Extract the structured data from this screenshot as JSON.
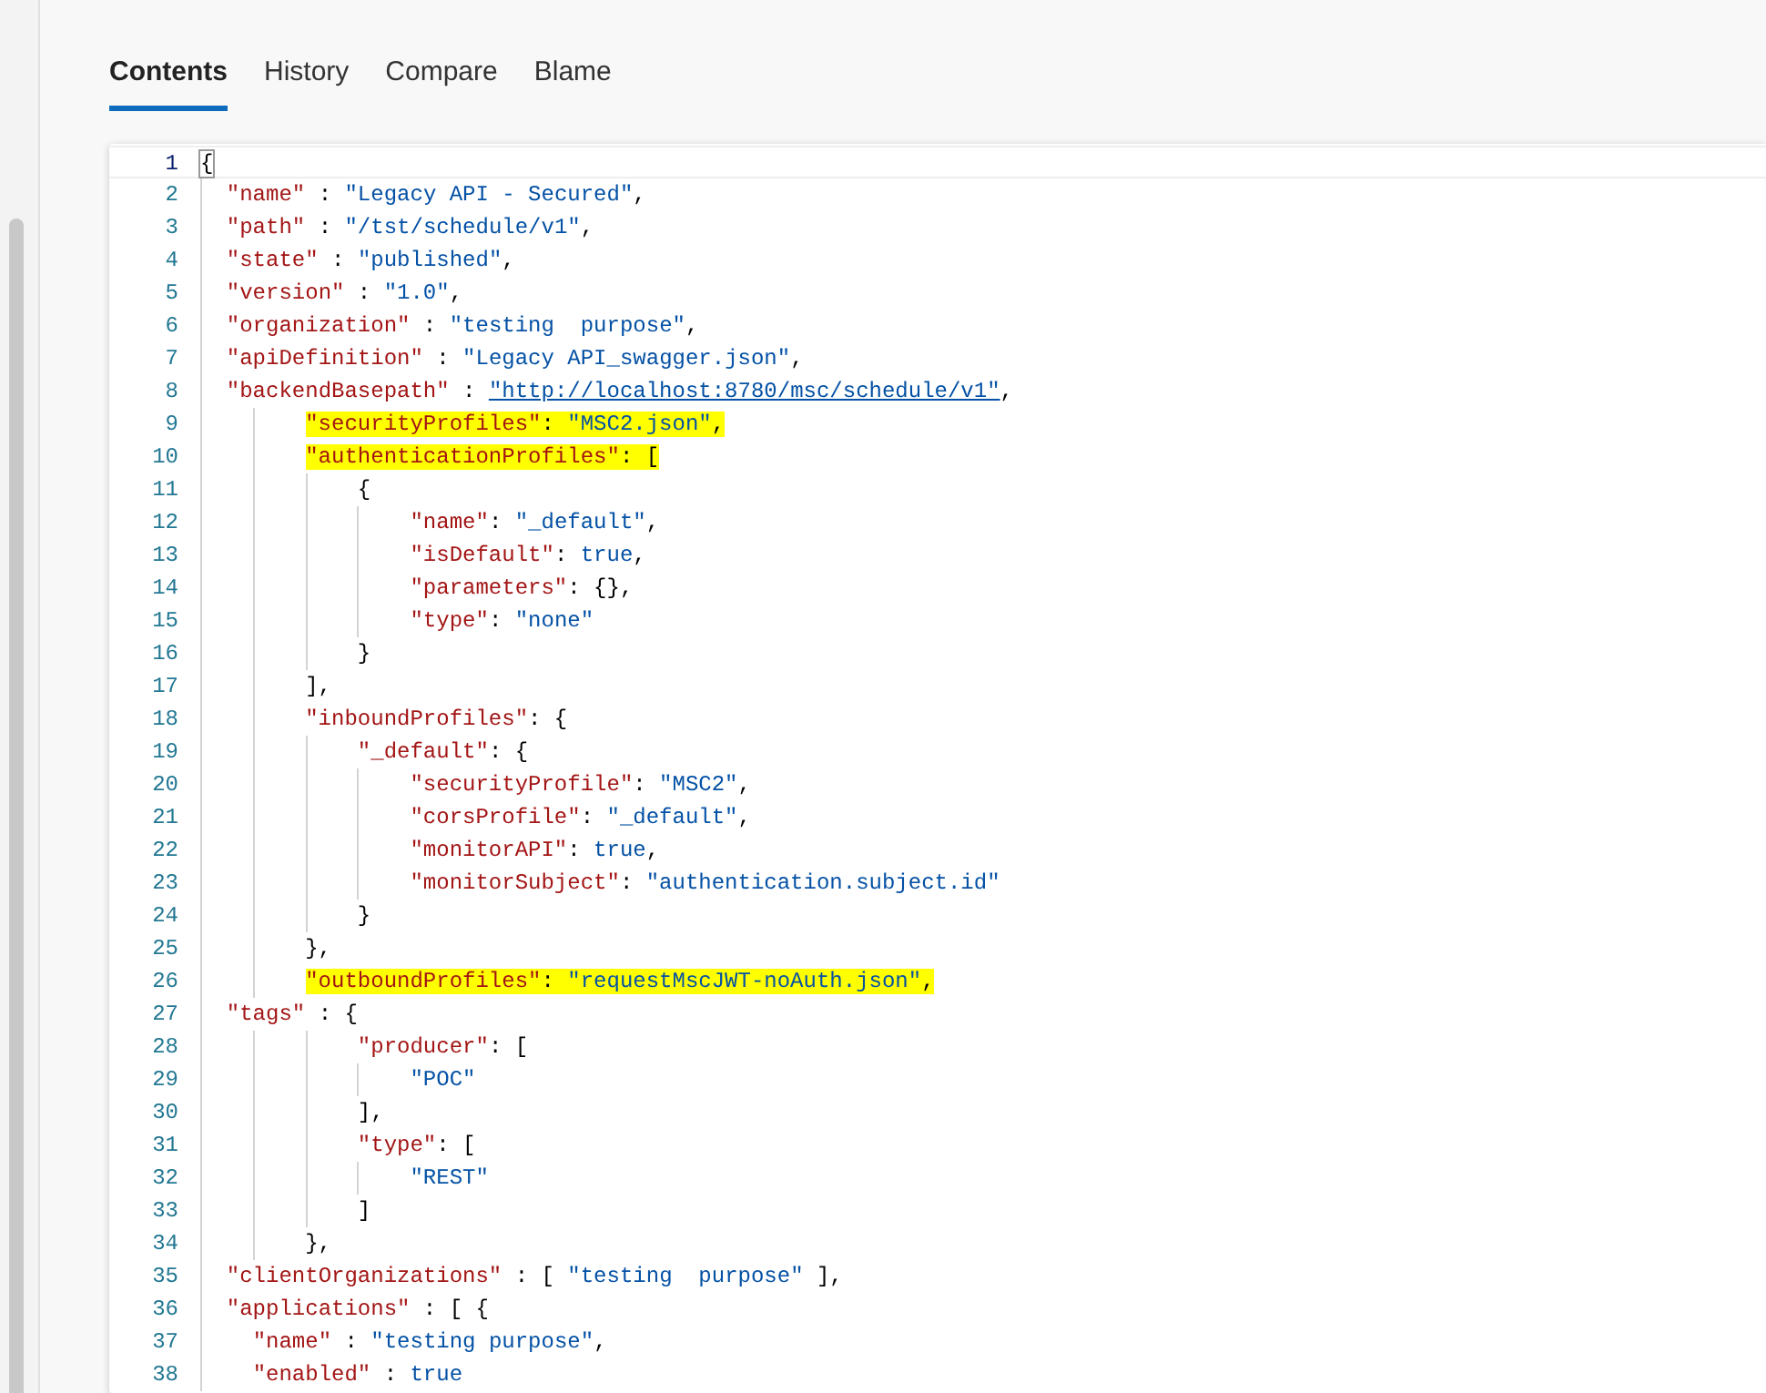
{
  "tabs": [
    {
      "label": "Contents",
      "selected": true
    },
    {
      "label": "History",
      "selected": false
    },
    {
      "label": "Compare",
      "selected": false
    },
    {
      "label": "Blame",
      "selected": false
    }
  ],
  "editor": {
    "lines": [
      {
        "number": "1",
        "text": "{",
        "highlighted": false,
        "current": true
      },
      {
        "number": "2",
        "text": "  \"name\" : \"Legacy API - Secured\",",
        "highlighted": false,
        "current": false
      },
      {
        "number": "3",
        "text": "  \"path\" : \"/tst/schedule/v1\",",
        "highlighted": false,
        "current": false
      },
      {
        "number": "4",
        "text": "  \"state\" : \"published\",",
        "highlighted": false,
        "current": false
      },
      {
        "number": "5",
        "text": "  \"version\" : \"1.0\",",
        "highlighted": false,
        "current": false
      },
      {
        "number": "6",
        "text": "  \"organization\" : \"testing  purpose\",",
        "highlighted": false,
        "current": false
      },
      {
        "number": "7",
        "text": "  \"apiDefinition\" : \"Legacy API_swagger.json\",",
        "highlighted": false,
        "current": false
      },
      {
        "number": "8",
        "text": "  \"backendBasepath\" : \"http://localhost:8780/msc/schedule/v1\",",
        "highlighted": false,
        "current": false,
        "link": true
      },
      {
        "number": "9",
        "text": "        \"securityProfiles\": \"MSC2.json\",",
        "highlighted": true,
        "current": false
      },
      {
        "number": "10",
        "text": "        \"authenticationProfiles\": [",
        "highlighted": true,
        "current": false
      },
      {
        "number": "11",
        "text": "            {",
        "highlighted": false,
        "current": false
      },
      {
        "number": "12",
        "text": "                \"name\": \"_default\",",
        "highlighted": false,
        "current": false
      },
      {
        "number": "13",
        "text": "                \"isDefault\": true,",
        "highlighted": false,
        "current": false
      },
      {
        "number": "14",
        "text": "                \"parameters\": {},",
        "highlighted": false,
        "current": false
      },
      {
        "number": "15",
        "text": "                \"type\": \"none\"",
        "highlighted": false,
        "current": false
      },
      {
        "number": "16",
        "text": "            }",
        "highlighted": false,
        "current": false
      },
      {
        "number": "17",
        "text": "        ],",
        "highlighted": false,
        "current": false
      },
      {
        "number": "18",
        "text": "        \"inboundProfiles\": {",
        "highlighted": false,
        "current": false
      },
      {
        "number": "19",
        "text": "            \"_default\": {",
        "highlighted": false,
        "current": false
      },
      {
        "number": "20",
        "text": "                \"securityProfile\": \"MSC2\",",
        "highlighted": false,
        "current": false
      },
      {
        "number": "21",
        "text": "                \"corsProfile\": \"_default\",",
        "highlighted": false,
        "current": false
      },
      {
        "number": "22",
        "text": "                \"monitorAPI\": true,",
        "highlighted": false,
        "current": false
      },
      {
        "number": "23",
        "text": "                \"monitorSubject\": \"authentication.subject.id\"",
        "highlighted": false,
        "current": false
      },
      {
        "number": "24",
        "text": "            }",
        "highlighted": false,
        "current": false
      },
      {
        "number": "25",
        "text": "        },",
        "highlighted": false,
        "current": false
      },
      {
        "number": "26",
        "text": "        \"outboundProfiles\": \"requestMscJWT-noAuth.json\",",
        "highlighted": true,
        "current": false
      },
      {
        "number": "27",
        "text": "  \"tags\" : {",
        "highlighted": false,
        "current": false
      },
      {
        "number": "28",
        "text": "            \"producer\": [",
        "highlighted": false,
        "current": false
      },
      {
        "number": "29",
        "text": "                \"POC\"",
        "highlighted": false,
        "current": false
      },
      {
        "number": "30",
        "text": "            ],",
        "highlighted": false,
        "current": false
      },
      {
        "number": "31",
        "text": "            \"type\": [",
        "highlighted": false,
        "current": false
      },
      {
        "number": "32",
        "text": "                \"REST\"",
        "highlighted": false,
        "current": false
      },
      {
        "number": "33",
        "text": "            ]",
        "highlighted": false,
        "current": false
      },
      {
        "number": "34",
        "text": "        },",
        "highlighted": false,
        "current": false
      },
      {
        "number": "35",
        "text": "  \"clientOrganizations\" : [ \"testing  purpose\" ],",
        "highlighted": false,
        "current": false
      },
      {
        "number": "36",
        "text": "  \"applications\" : [ {",
        "highlighted": false,
        "current": false
      },
      {
        "number": "37",
        "text": "    \"name\" : \"testing purpose\",",
        "highlighted": false,
        "current": false
      },
      {
        "number": "38",
        "text": "    \"enabled\" : true",
        "highlighted": false,
        "current": false
      }
    ]
  }
}
